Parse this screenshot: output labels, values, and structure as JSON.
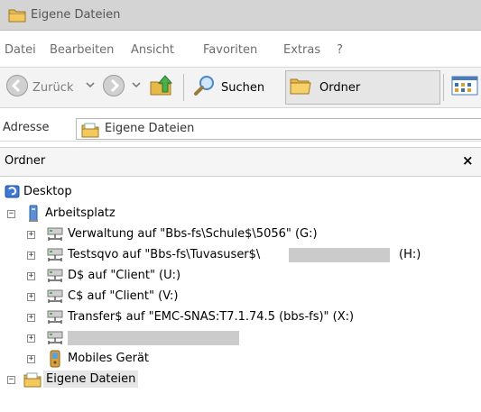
{
  "window": {
    "title": "Eigene Dateien"
  },
  "menu": {
    "items": [
      "Datei",
      "Bearbeiten",
      "Ansicht",
      "Favoriten",
      "Extras",
      "?"
    ]
  },
  "toolbar": {
    "back_label": "Zurück",
    "search_label": "Suchen",
    "folders_label": "Ordner"
  },
  "address": {
    "label": "Adresse",
    "value": "Eigene Dateien"
  },
  "panel": {
    "title": "Ordner",
    "close": "×"
  },
  "tree": {
    "desktop": "Desktop",
    "computer": "Arbeitsplatz",
    "drives": [
      "Verwaltung auf \"Bbs-fs\\Schule$\\5056\" (G:)",
      "Testsqvo auf \"Bbs-fs\\Tuvasuser$\\",
      "D$ auf \"Client\" (U:)",
      "C$ auf \"Client\" (V:)",
      "Transfer$ auf \"EMC-SNAS:T7.1.74.5 (bbs-fs)\" (X:)"
    ],
    "drive_h_suffix": "(H:)",
    "mobile": "Mobiles Gerät",
    "my_documents": "Eigene Dateien"
  }
}
